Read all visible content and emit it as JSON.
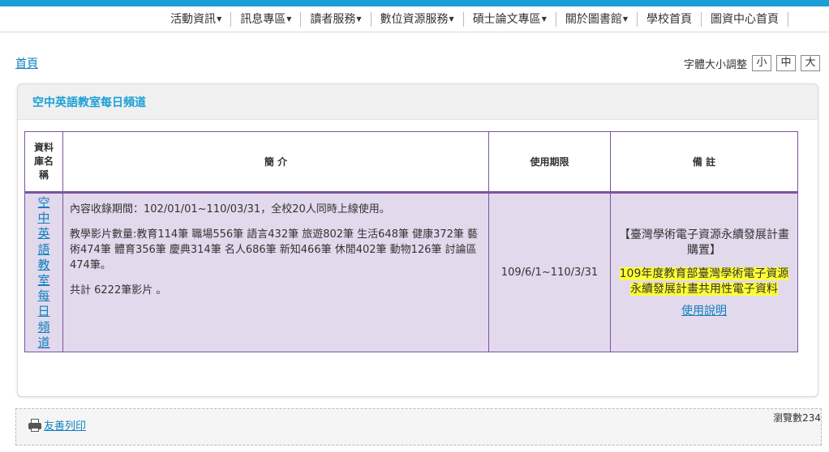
{
  "nav": {
    "items": [
      {
        "label": "活動資訊",
        "has_caret": true
      },
      {
        "label": "訊息專區",
        "has_caret": true
      },
      {
        "label": "讀者服務",
        "has_caret": true
      },
      {
        "label": "數位資源服務",
        "has_caret": true
      },
      {
        "label": "碩士論文專區",
        "has_caret": true
      },
      {
        "label": "關於圖書館",
        "has_caret": true
      },
      {
        "label": "學校首頁",
        "has_caret": false
      },
      {
        "label": "圖資中心首頁",
        "has_caret": false
      }
    ],
    "caret": "▼"
  },
  "breadcrumb": {
    "home": "首頁"
  },
  "font_size": {
    "label": "字體大小調整",
    "small": "小",
    "medium": "中",
    "large": "大"
  },
  "panel": {
    "title": "空中英語教室每日頻道"
  },
  "table": {
    "headers": {
      "name": "資料庫名稱",
      "intro": "簡 介",
      "period": "使用期限",
      "note": "備 註"
    },
    "row": {
      "name": "空中英語教室每日頻道",
      "intro_line1": "內容收錄期間：102/01/01~110/03/31，全校20人同時上線使用。",
      "intro_line2": "教學影片數量:教育114筆 職場556筆 語言432筆 旅遊802筆 生活648筆 健康372筆 藝術474筆 體育356筆 慶典314筆 名人686筆 新知466筆 休閒402筆 動物126筆 討論區474筆。",
      "intro_line3": "共計 6222筆影片 。",
      "period": "109/6/1~110/3/31",
      "note_title": "【臺灣學術電子資源永續發展計畫購置】",
      "note_highlight": "109年度教育部臺灣學術電子資源永續發展計畫共用性電子資料",
      "note_link": "使用說明"
    }
  },
  "footer": {
    "print": "友善列印",
    "views": "瀏覽數234"
  },
  "colors": {
    "accent": "#1a9fd6",
    "link": "#0e7fbf",
    "table_border": "#7a55a0",
    "row_bg": "#e2d9ec",
    "highlight": "#ffff33"
  }
}
